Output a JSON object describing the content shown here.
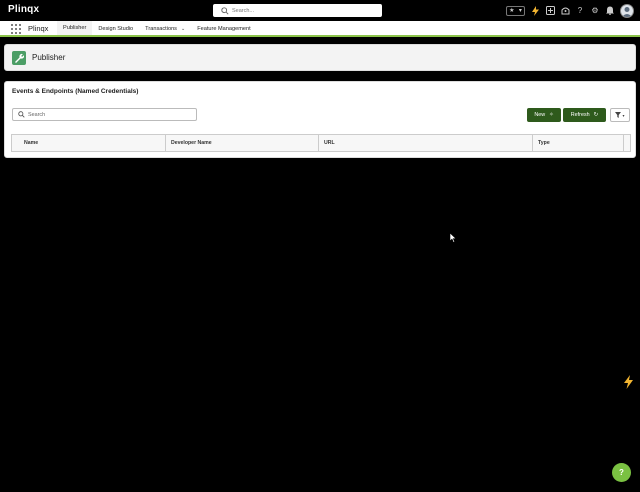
{
  "app": {
    "logo_text": "Plinqx",
    "global_search": {
      "placeholder": "Search..."
    },
    "app_name": "Plinqx"
  },
  "nav": {
    "tabs": [
      {
        "label": "Publisher",
        "active": true
      },
      {
        "label": "Design Studio",
        "active": false
      },
      {
        "label": "Transactions",
        "active": false,
        "has_dropdown": true
      },
      {
        "label": "Feature Management",
        "active": false
      }
    ]
  },
  "page_header": {
    "title": "Publisher",
    "icon": "wrench-icon"
  },
  "list": {
    "title": "Events & Endpoints (Named Credentials)",
    "search_placeholder": "Search",
    "new_label": "New",
    "refresh_label": "Refresh",
    "columns": [
      "Name",
      "Developer Name",
      "URL",
      "Type"
    ],
    "rows": []
  },
  "help": {
    "label": "?"
  },
  "colors": {
    "accent_green": "#8bc34a",
    "button_dark_green": "#2e5a1c",
    "icon_green": "#4c9e66",
    "help_green": "#7ac142",
    "bolt_yellow": "#f2b531"
  }
}
